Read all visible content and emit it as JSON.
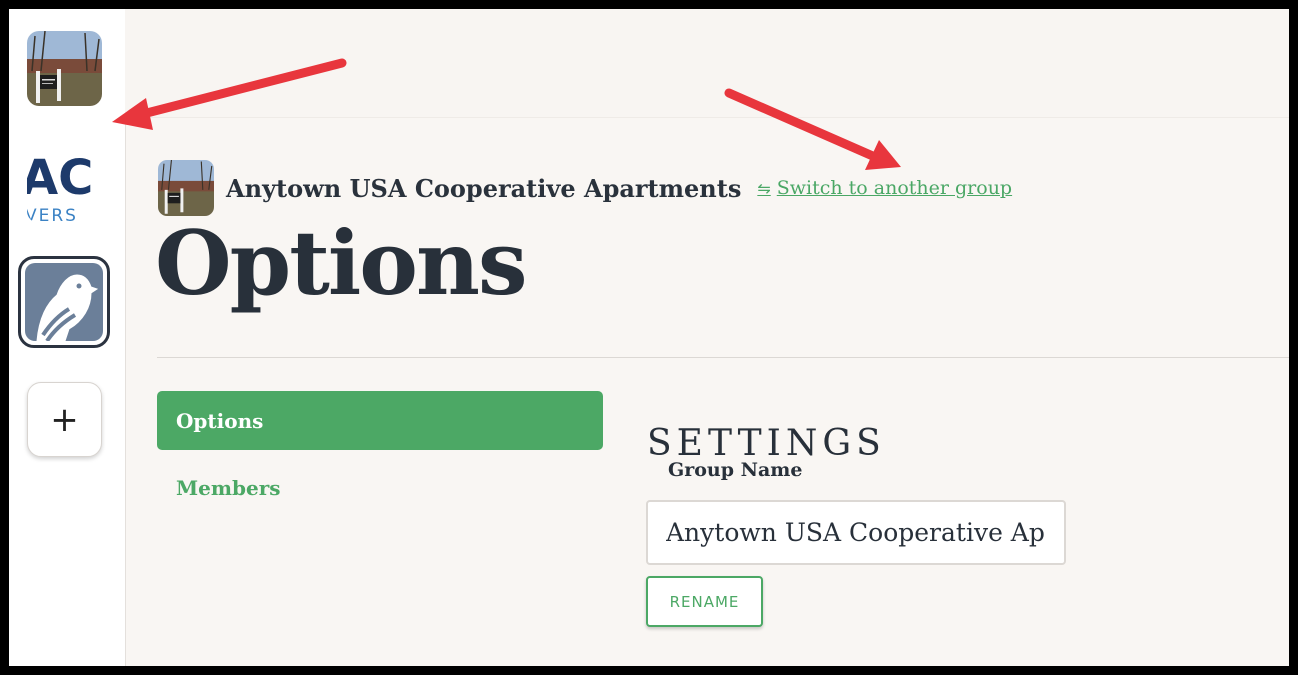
{
  "sidebar": {
    "groups": [
      {
        "name": "Anytown USA Cooperative Apartments"
      },
      {
        "name": "AC group",
        "logo_text": "AC",
        "logo_subtext": "VERS"
      },
      {
        "name": "Pigeon app group"
      }
    ],
    "add_label": "+"
  },
  "header": {
    "group_title": "Anytown USA Cooperative Apartments",
    "switch_icon": "⇋",
    "switch_link": "Switch to another group"
  },
  "page": {
    "title": "Options"
  },
  "nav": {
    "options": "Options",
    "members": "Members"
  },
  "settings": {
    "heading": "SETTINGS",
    "group_name_label": "Group Name",
    "group_name_value": "Anytown USA Cooperative Apartments",
    "rename_button": "RENAME"
  },
  "colors": {
    "accent": "#4ca865",
    "text_dark": "#28303a",
    "background": "#f9f6f3",
    "annotation_arrow": "#e8363d"
  },
  "icons": {
    "switch": "arrows-swap-icon",
    "add": "plus-icon"
  }
}
